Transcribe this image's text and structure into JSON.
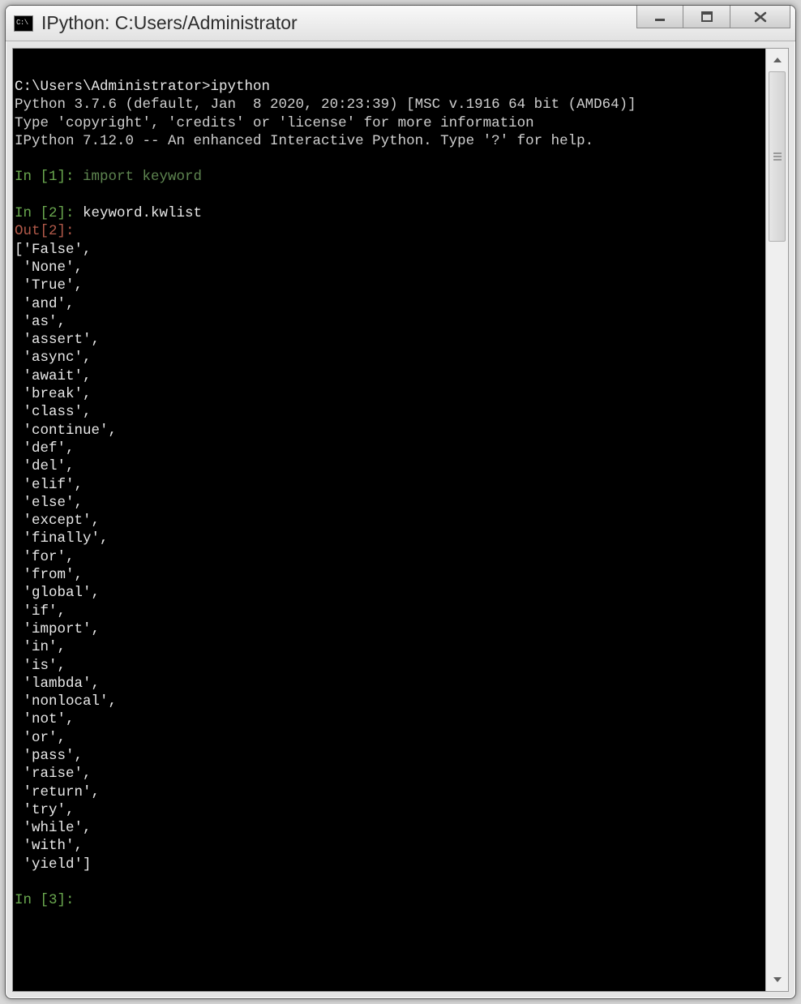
{
  "window": {
    "icon_label": "C:\\",
    "title": "IPython: C:Users/Administrator"
  },
  "terminal": {
    "prompt_line": "C:\\Users\\Administrator>ipython",
    "banner1": "Python 3.7.6 (default, Jan  8 2020, 20:23:39) [MSC v.1916 64 bit (AMD64)]",
    "banner2": "Type 'copyright', 'credits' or 'license' for more information",
    "banner3": "IPython 7.12.0 -- An enhanced Interactive Python. Type '?' for help.",
    "in1_label": "In [1]: ",
    "in1_cmd": "import keyword",
    "in2_label": "In [2]: ",
    "in2_cmd": "keyword.kwlist",
    "out2_label": "Out[2]:",
    "kwlist": [
      "False",
      "None",
      "True",
      "and",
      "as",
      "assert",
      "async",
      "await",
      "break",
      "class",
      "continue",
      "def",
      "del",
      "elif",
      "else",
      "except",
      "finally",
      "for",
      "from",
      "global",
      "if",
      "import",
      "in",
      "is",
      "lambda",
      "nonlocal",
      "not",
      "or",
      "pass",
      "raise",
      "return",
      "try",
      "while",
      "with",
      "yield"
    ],
    "in3_label": "In [3]: "
  }
}
